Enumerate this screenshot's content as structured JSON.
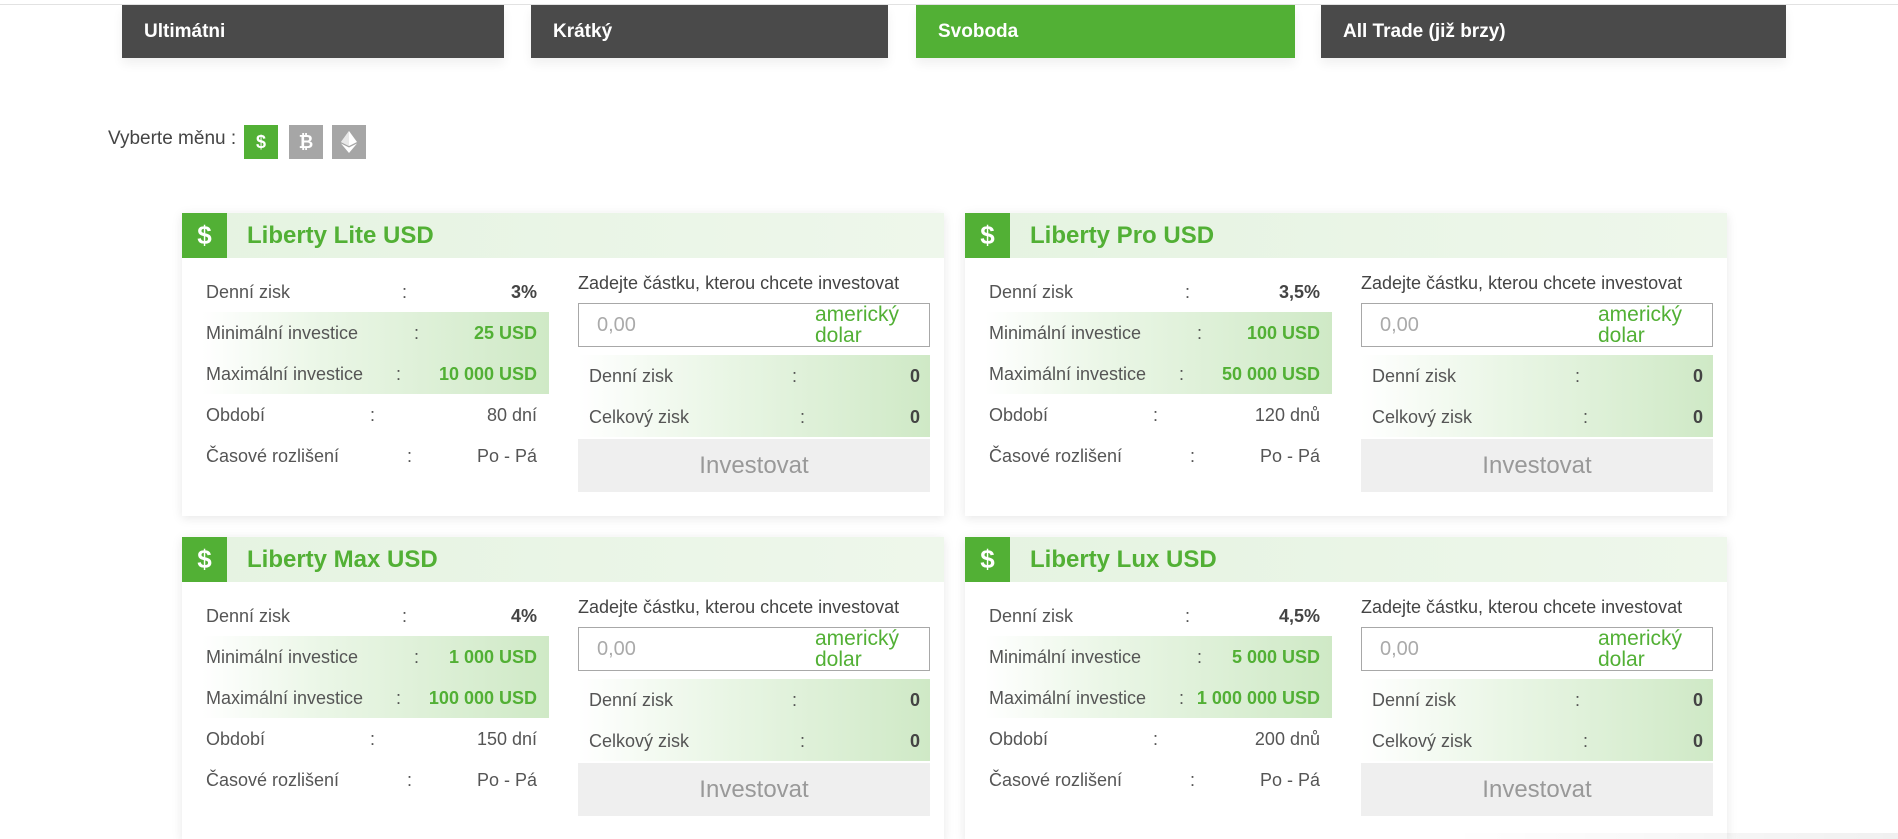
{
  "tabs": [
    {
      "label": "Ultimátni",
      "active": false
    },
    {
      "label": "Krátký",
      "active": false
    },
    {
      "label": "Svoboda",
      "active": true
    },
    {
      "label": "All Trade (již brzy)",
      "active": false
    }
  ],
  "currency_selector": {
    "label": "Vyberte měnu :",
    "options": [
      {
        "name": "usd",
        "glyph": "$",
        "icon": "dollar-icon",
        "active": true
      },
      {
        "name": "btc",
        "glyph": "₿",
        "icon": "bitcoin-icon",
        "active": false
      },
      {
        "name": "eth",
        "glyph": "",
        "icon": "ethereum-icon",
        "active": false
      }
    ]
  },
  "colors": {
    "accent": "#52b035",
    "tab_dark": "#4a4a4a",
    "button_disabled": "#efefef"
  },
  "plans": [
    {
      "icon_glyph": "$",
      "title": "Liberty Lite USD",
      "rows": [
        {
          "label": "Denní zisk",
          "value": "3%"
        },
        {
          "label": "Minimální investice",
          "value": "25 USD"
        },
        {
          "label": "Maximální investice",
          "value": "10 000 USD"
        },
        {
          "label": "Období",
          "value": "80 dní"
        },
        {
          "label": "Časové rozlišení",
          "value": "Po - Pá"
        }
      ],
      "calc_title": "Zadejte částku, kterou chcete investovat",
      "amount_placeholder": "0,00",
      "amount_unit": "americký dolar",
      "daily_profit_label": "Denní zisk",
      "daily_profit_value": "0",
      "total_profit_label": "Celkový zisk",
      "total_profit_value": "0",
      "invest_label": "Investovat"
    },
    {
      "icon_glyph": "$",
      "title": "Liberty Pro USD",
      "rows": [
        {
          "label": "Denní zisk",
          "value": "3,5%"
        },
        {
          "label": "Minimální investice",
          "value": "100 USD"
        },
        {
          "label": "Maximální investice",
          "value": "50 000 USD"
        },
        {
          "label": "Období",
          "value": "120 dnů"
        },
        {
          "label": "Časové rozlišení",
          "value": "Po - Pá"
        }
      ],
      "calc_title": "Zadejte částku, kterou chcete investovat",
      "amount_placeholder": "0,00",
      "amount_unit": "americký dolar",
      "daily_profit_label": "Denní zisk",
      "daily_profit_value": "0",
      "total_profit_label": "Celkový zisk",
      "total_profit_value": "0",
      "invest_label": "Investovat"
    },
    {
      "icon_glyph": "$",
      "title": "Liberty Max USD",
      "rows": [
        {
          "label": "Denní zisk",
          "value": "4%"
        },
        {
          "label": "Minimální investice",
          "value": "1 000 USD"
        },
        {
          "label": "Maximální investice",
          "value": "100 000 USD"
        },
        {
          "label": "Období",
          "value": "150 dní"
        },
        {
          "label": "Časové rozlišení",
          "value": "Po - Pá"
        }
      ],
      "calc_title": "Zadejte částku, kterou chcete investovat",
      "amount_placeholder": "0,00",
      "amount_unit": "americký dolar",
      "daily_profit_label": "Denní zisk",
      "daily_profit_value": "0",
      "total_profit_label": "Celkový zisk",
      "total_profit_value": "0",
      "invest_label": "Investovat"
    },
    {
      "icon_glyph": "$",
      "title": "Liberty Lux USD",
      "rows": [
        {
          "label": "Denní zisk",
          "value": "4,5%"
        },
        {
          "label": "Minimální investice",
          "value": "5 000 USD"
        },
        {
          "label": "Maximální investice",
          "value": "1 000 000 USD"
        },
        {
          "label": "Období",
          "value": "200 dnů"
        },
        {
          "label": "Časové rozlišení",
          "value": "Po - Pá"
        }
      ],
      "calc_title": "Zadejte částku, kterou chcete investovat",
      "amount_placeholder": "0,00",
      "amount_unit": "americký dolar",
      "daily_profit_label": "Denní zisk",
      "daily_profit_value": "0",
      "total_profit_label": "Celkový zisk",
      "total_profit_value": "0",
      "invest_label": "Investovat"
    }
  ]
}
